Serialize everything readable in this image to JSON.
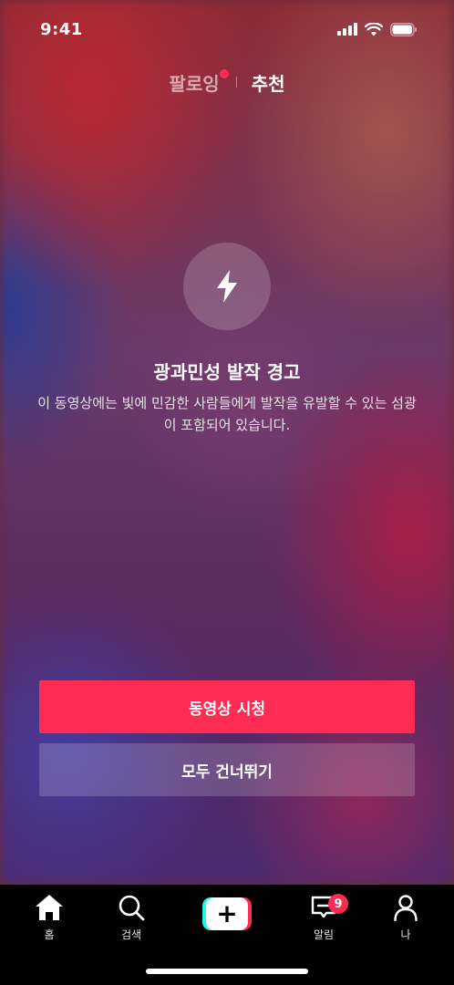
{
  "status_bar": {
    "time": "9:41"
  },
  "header": {
    "tab_following": "팔로잉",
    "tab_recommend": "추천"
  },
  "warning": {
    "icon": "bolt-icon",
    "title": "광과민성 발작 경고",
    "body": "이 동영상에는 빛에 민감한 사람들에게 발작을 유발할 수 있는 섬광이 포함되어 있습니다."
  },
  "buttons": {
    "watch_label": "동영상 시청",
    "skip_label": "모두 건너뛰기"
  },
  "tab_bar": {
    "home": "홈",
    "search": "검색",
    "create_icon": "plus-icon",
    "inbox": "알림",
    "inbox_badge": "9",
    "me": "나"
  },
  "colors": {
    "accent": "#fe2c55",
    "create_cyan": "#25f4ee",
    "tab_bar_bg": "#000000"
  }
}
